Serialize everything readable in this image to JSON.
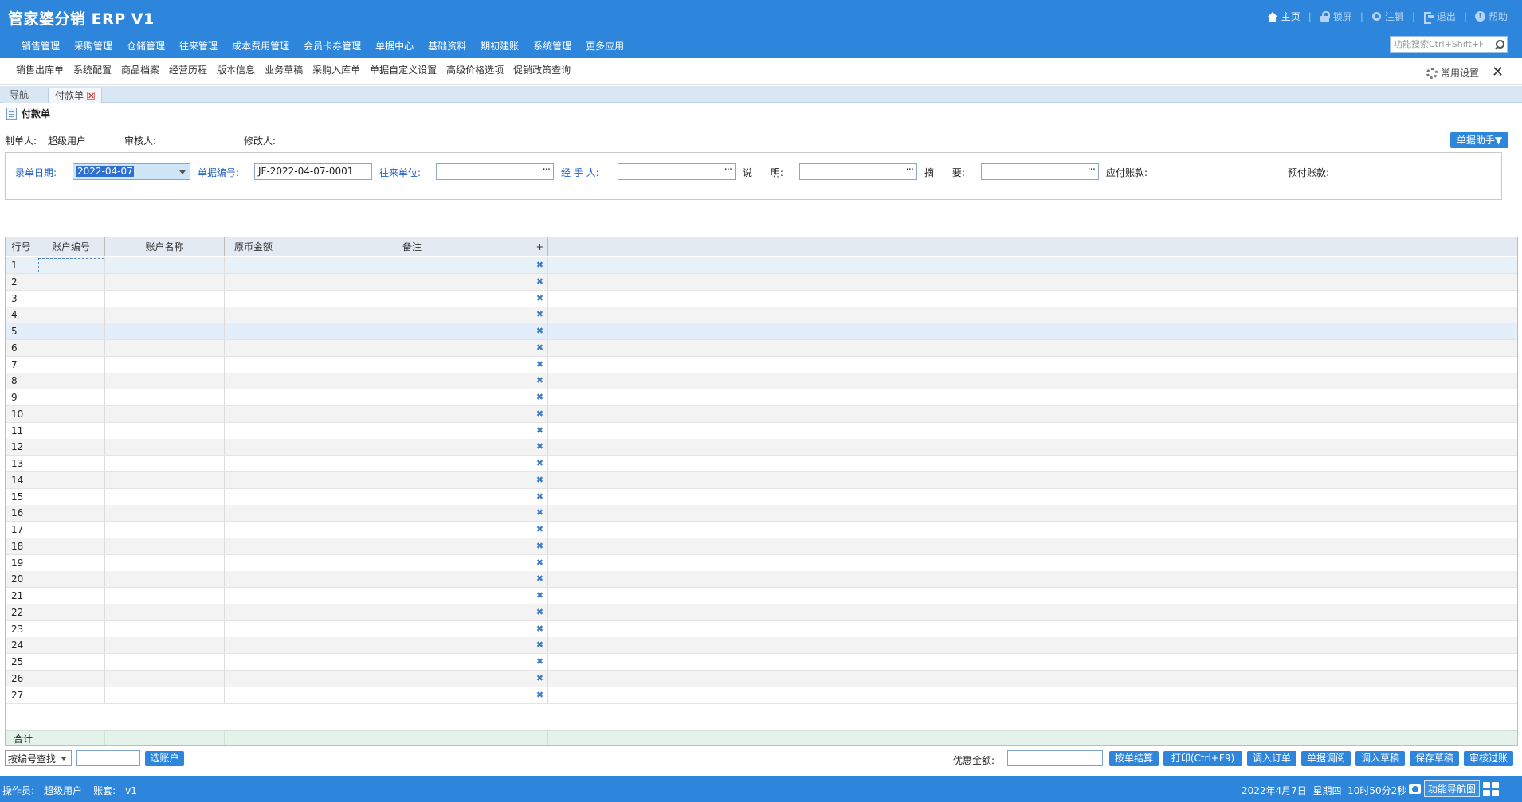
{
  "app": {
    "title": "管家婆分销 ERP V1"
  },
  "top_links": {
    "home": "主页",
    "lock": "锁屏",
    "logout": "注销",
    "exit": "退出",
    "help": "帮助",
    "sep": "|"
  },
  "main_menu": [
    "销售管理",
    "采购管理",
    "仓储管理",
    "往来管理",
    "成本费用管理",
    "会员卡券管理",
    "单据中心",
    "基础资料",
    "期初建账",
    "系统管理",
    "更多应用"
  ],
  "search": {
    "placeholder": "功能搜索Ctrl+Shift+F"
  },
  "shortcuts": [
    "销售出库单",
    "系统配置",
    "商品档案",
    "经营历程",
    "版本信息",
    "业务草稿",
    "采购入库单",
    "单据自定义设置",
    "高级价格选项",
    "促销政策查询"
  ],
  "common_settings": "常用设置",
  "close_glyph": "✕",
  "tabs": {
    "nav": "导航",
    "active": "付款单"
  },
  "page": {
    "title": "付款单"
  },
  "meta": {
    "creator_label": "制单人:",
    "creator_value": "超级用户",
    "auditor_label": "审核人:",
    "auditor_value": "",
    "modifier_label": "修改人:",
    "modifier_value": ""
  },
  "helper_button": "单据助手▼",
  "form": {
    "date_label": "录单日期:",
    "date_value": "2022-04-07",
    "docno_label": "单据编号:",
    "docno_value": "JF-2022-04-07-0001",
    "partner_label": "往来单位:",
    "handler_label": "经 手 人:",
    "desc_label": "说      明:",
    "summary_label": "摘      要:",
    "payable_label": "应付账款:",
    "prepaid_label": "预付账款:",
    "ellipsis": "···"
  },
  "grid": {
    "headers": {
      "rownum": "行号",
      "account_code": "账户编号",
      "account_name": "账户名称",
      "amount": "原币金额",
      "remark": "备注",
      "add": "+"
    },
    "rows": [
      "1",
      "2",
      "3",
      "4",
      "5",
      "6",
      "7",
      "8",
      "9",
      "10",
      "11",
      "12",
      "13",
      "14",
      "15",
      "16",
      "17",
      "18",
      "19",
      "20",
      "21",
      "22",
      "23",
      "24",
      "25",
      "26",
      "27"
    ],
    "delete_glyph": "✖",
    "total_label": "合计"
  },
  "bottom": {
    "lookup_select": "按编号查找",
    "choose_account": "选账户",
    "discount_label": "优惠金额:",
    "buttons": [
      "按单结算",
      "打印(Ctrl+F9)",
      "调入订单",
      "单据调阅",
      "调入草稿",
      "保存草稿",
      "审核过账"
    ]
  },
  "status": {
    "operator_label": "操作员:",
    "operator": "超级用户",
    "book_label": "账套:",
    "book": "v1",
    "datetime": "2022年4月7日  星期四  10时50分2秒",
    "nav_map": "功能导航图"
  },
  "colors": {
    "brand": "#2e86dc",
    "label_blue": "#1e5fc6"
  }
}
